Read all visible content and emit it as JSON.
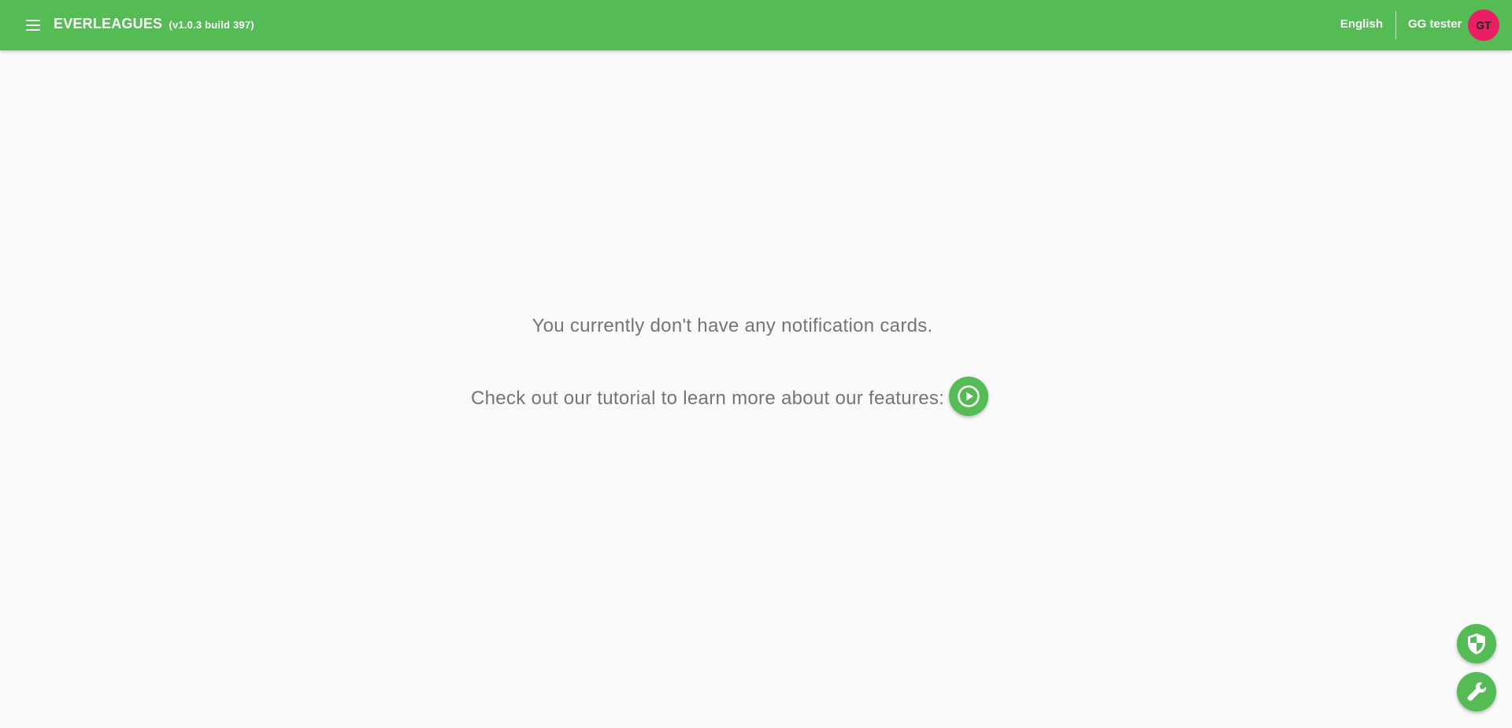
{
  "header": {
    "app_name": "EVERLEAGUES",
    "version": "(v1.0.3 build 397)",
    "language": "English",
    "user_name": "GG tester",
    "avatar_initials": "GT"
  },
  "main": {
    "empty_message": "You currently don't have any notification cards.",
    "tutorial_prompt": "Check out our tutorial to learn more about our features:"
  },
  "icons": {
    "menu": "menu-icon",
    "tutorial": "play-circle-icon",
    "fab_1": "shield-icon",
    "fab_2": "wrench-icon"
  },
  "colors": {
    "brand_green": "#55bb55",
    "avatar_bg": "#e91e63",
    "text_gray": "#757575",
    "page_bg": "#fafafa"
  }
}
